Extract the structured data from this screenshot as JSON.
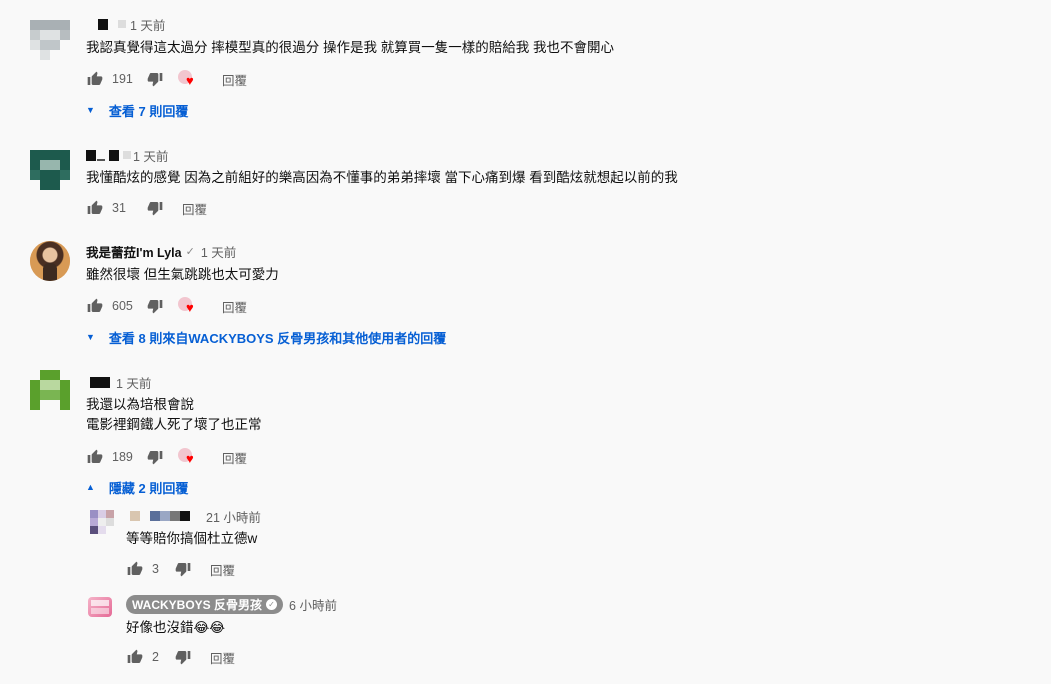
{
  "comments": [
    {
      "time": "1 天前",
      "text": "我認真覺得這太過分  摔模型真的很過分 操作是我 就算買一隻一樣的賠給我 我也不會開心",
      "likes": "191",
      "reply_label": "回覆",
      "creator_heart": true,
      "view_replies": "查看 7 則回覆"
    },
    {
      "time": "1 天前",
      "text": "我懂酷炫的感覺 因為之前組好的樂高因為不懂事的弟弟摔壞 當下心痛到爆 看到酷炫就想起以前的我",
      "likes": "31",
      "reply_label": "回覆",
      "creator_heart": false
    },
    {
      "author": "我是蕾菈I'm Lyla",
      "time": "1 天前",
      "text": "雖然很壞 但生氣跳跳也太可愛力",
      "likes": "605",
      "reply_label": "回覆",
      "creator_heart": true,
      "view_replies": "查看 8 則來自WACKYBOYS 反骨男孩和其他使用者的回覆"
    },
    {
      "time": "1 天前",
      "text_lines": [
        "我還以為培根會說",
        "電影裡鋼鐵人死了壞了也正常"
      ],
      "likes": "189",
      "reply_label": "回覆",
      "creator_heart": true,
      "hide_replies": "隱藏 2 則回覆",
      "replies": [
        {
          "time": "21 小時前",
          "text": "等等賠你搞個杜立德w",
          "likes": "3",
          "reply_label": "回覆"
        },
        {
          "author": "WACKYBOYS 反骨男孩",
          "time": "6 小時前",
          "text": "好像也沒錯😂😂",
          "likes": "2",
          "reply_label": "回覆"
        }
      ]
    }
  ],
  "colors": {
    "link_blue": "#065fd4",
    "heart_red": "#ff0000",
    "meta_gray": "#606060",
    "background": "#f9f9f9"
  },
  "icons": [
    "thumb-up-icon",
    "thumb-down-icon",
    "heart-icon",
    "chevron-down-icon",
    "chevron-up-icon",
    "verified-icon"
  ]
}
